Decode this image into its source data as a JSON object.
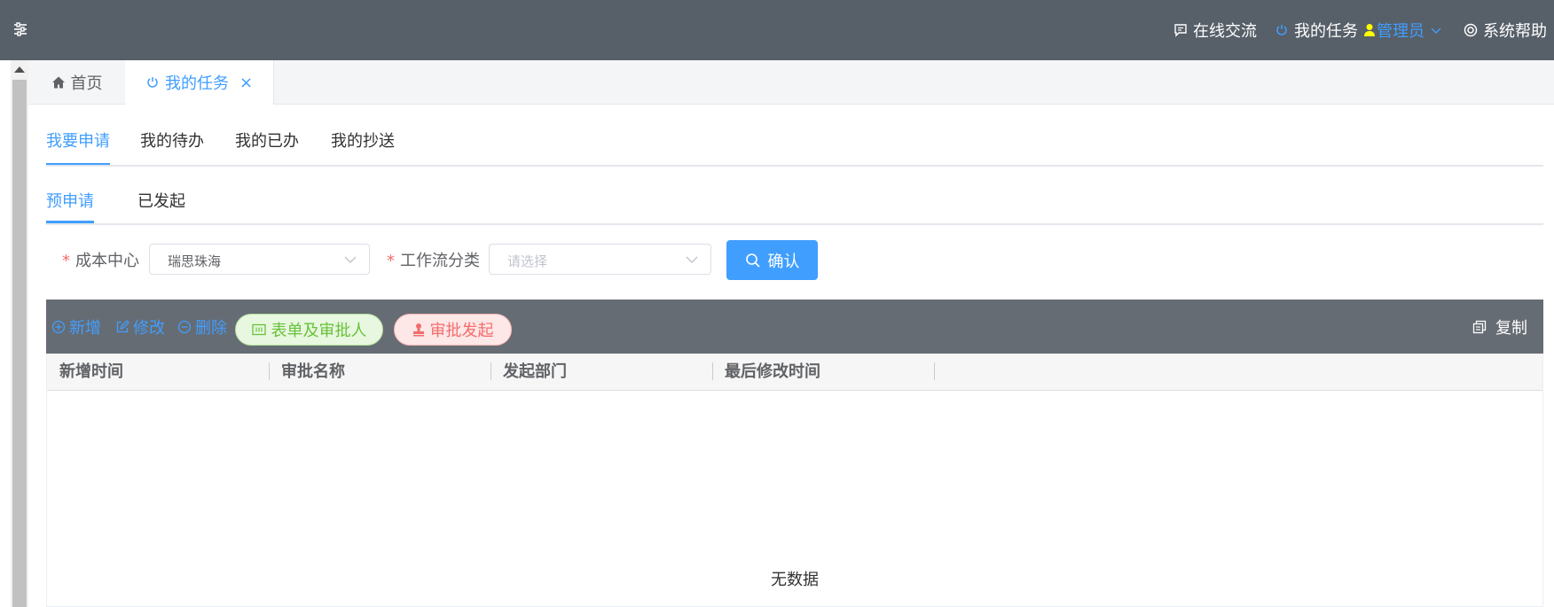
{
  "header": {
    "chat_label": "在线交流",
    "my_tasks_label": "我的任务",
    "user_name": "管理员",
    "help_label": "系统帮助"
  },
  "tags": [
    {
      "label": "首页"
    },
    {
      "label": "我的任务",
      "close": "×"
    }
  ],
  "main_tabs": [
    {
      "label": "我要申请",
      "active": true
    },
    {
      "label": "我的待办"
    },
    {
      "label": "我的已办"
    },
    {
      "label": "我的抄送"
    }
  ],
  "sub_tabs": [
    {
      "label": "预申请",
      "active": true
    },
    {
      "label": "已发起"
    }
  ],
  "form": {
    "required_mark": "*",
    "cost_center_label": "成本中心",
    "cost_center_value": "瑞思珠海",
    "workflow_label": "工作流分类",
    "workflow_placeholder": "请选择",
    "confirm_label": "确认"
  },
  "toolbar": {
    "add_label": "新增",
    "edit_label": "修改",
    "delete_label": "删除",
    "form_approver_label": "表单及审批人",
    "start_label": "审批发起",
    "copy_label": "复制"
  },
  "table": {
    "columns": [
      "新增时间",
      "审批名称",
      "发起部门",
      "最后修改时间"
    ],
    "empty_text": "无数据"
  },
  "colors": {
    "topbar": "#575f68",
    "primary": "#409eff",
    "toolbar": "#666c74",
    "success": "#67c23a",
    "danger": "#f56c6c",
    "user_icon": "#ffff00"
  }
}
